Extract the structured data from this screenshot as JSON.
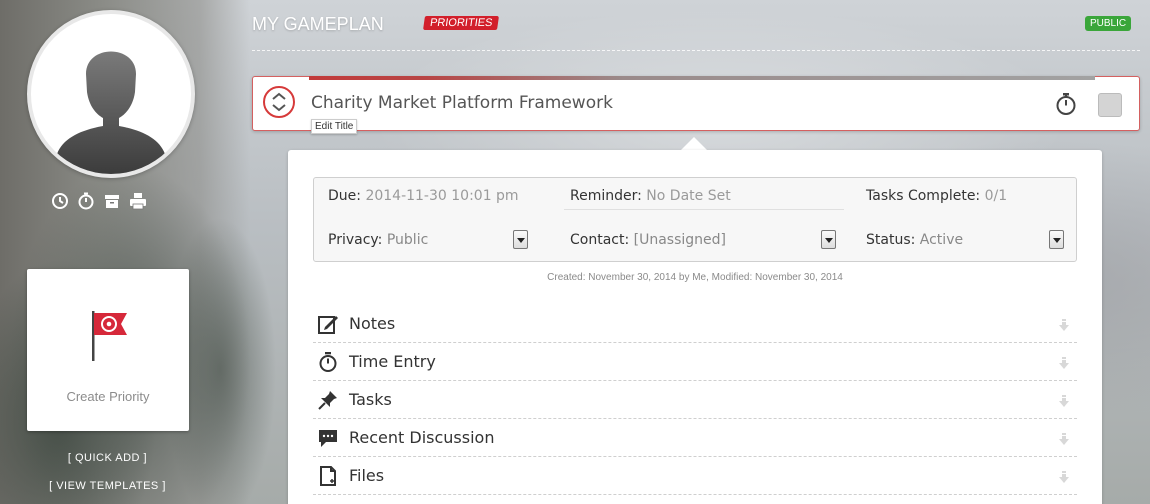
{
  "header": {
    "title": "MY GAMEPLAN",
    "tag": "PRIORITIES",
    "visibility_badge": "PUBLIC"
  },
  "sidebar": {
    "avatar_icon": "user-silhouette-icon",
    "actions": [
      {
        "icon": "history-icon"
      },
      {
        "icon": "stopwatch-icon"
      },
      {
        "icon": "archive-icon"
      },
      {
        "icon": "print-icon"
      }
    ],
    "create_card": {
      "icon": "flag-icon",
      "label": "Create Priority"
    },
    "quick_add": "[ QUICK ADD ]",
    "view_templates": "[ VIEW TEMPLATES ]"
  },
  "priority": {
    "title": "Charity Market Platform Framework",
    "edit_tooltip": "Edit Title",
    "due_label": "Due:",
    "due_value": "2014-11-30 10:01 pm",
    "reminder_label": "Reminder:",
    "reminder_value": "No Date Set",
    "tasks_label": "Tasks Complete:",
    "tasks_value": "0/1",
    "privacy_label": "Privacy:",
    "privacy_value": "Public",
    "contact_label": "Contact:",
    "contact_value": "[Unassigned]",
    "status_label": "Status:",
    "status_value": "Active",
    "created_line": "Created: November 30, 2014 by Me, Modified: November 30, 2014"
  },
  "sections": [
    {
      "label": "Notes",
      "icon": "edit-note-icon"
    },
    {
      "label": "Time Entry",
      "icon": "stopwatch-icon"
    },
    {
      "label": "Tasks",
      "icon": "pushpin-icon"
    },
    {
      "label": "Recent Discussion",
      "icon": "chat-bubble-icon"
    },
    {
      "label": "Files",
      "icon": "file-icon"
    }
  ],
  "colors": {
    "accent_red": "#d21f2b",
    "public_green": "#3aa63a"
  }
}
